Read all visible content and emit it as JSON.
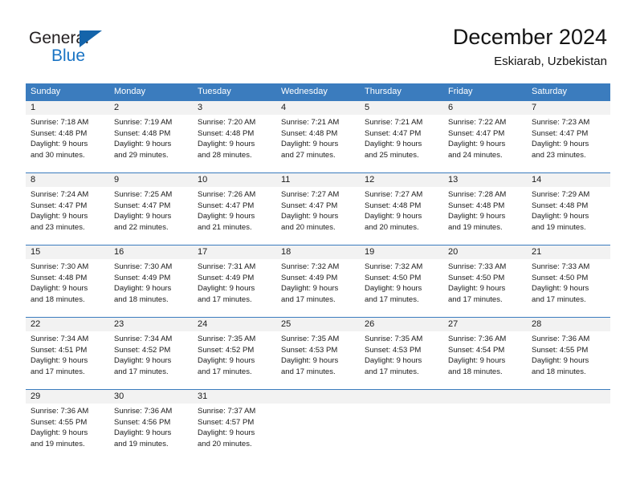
{
  "logo": {
    "word_top": "General",
    "word_bottom": "Blue",
    "triangle_color": "#1464aa",
    "blue_color": "#1a74c4"
  },
  "header": {
    "title": "December 2024",
    "subtitle": "Eskiarab, Uzbekistan"
  },
  "theme": {
    "header_blue": "#3b7cbe",
    "number_row_bg": "#f2f2f2",
    "text": "#1a1a1a"
  },
  "calendar": {
    "weekdays": [
      "Sunday",
      "Monday",
      "Tuesday",
      "Wednesday",
      "Thursday",
      "Friday",
      "Saturday"
    ],
    "weeks": [
      [
        {
          "day": "1",
          "sunrise": "Sunrise: 7:18 AM",
          "sunset": "Sunset: 4:48 PM",
          "daylight1": "Daylight: 9 hours",
          "daylight2": "and 30 minutes."
        },
        {
          "day": "2",
          "sunrise": "Sunrise: 7:19 AM",
          "sunset": "Sunset: 4:48 PM",
          "daylight1": "Daylight: 9 hours",
          "daylight2": "and 29 minutes."
        },
        {
          "day": "3",
          "sunrise": "Sunrise: 7:20 AM",
          "sunset": "Sunset: 4:48 PM",
          "daylight1": "Daylight: 9 hours",
          "daylight2": "and 28 minutes."
        },
        {
          "day": "4",
          "sunrise": "Sunrise: 7:21 AM",
          "sunset": "Sunset: 4:48 PM",
          "daylight1": "Daylight: 9 hours",
          "daylight2": "and 27 minutes."
        },
        {
          "day": "5",
          "sunrise": "Sunrise: 7:21 AM",
          "sunset": "Sunset: 4:47 PM",
          "daylight1": "Daylight: 9 hours",
          "daylight2": "and 25 minutes."
        },
        {
          "day": "6",
          "sunrise": "Sunrise: 7:22 AM",
          "sunset": "Sunset: 4:47 PM",
          "daylight1": "Daylight: 9 hours",
          "daylight2": "and 24 minutes."
        },
        {
          "day": "7",
          "sunrise": "Sunrise: 7:23 AM",
          "sunset": "Sunset: 4:47 PM",
          "daylight1": "Daylight: 9 hours",
          "daylight2": "and 23 minutes."
        }
      ],
      [
        {
          "day": "8",
          "sunrise": "Sunrise: 7:24 AM",
          "sunset": "Sunset: 4:47 PM",
          "daylight1": "Daylight: 9 hours",
          "daylight2": "and 23 minutes."
        },
        {
          "day": "9",
          "sunrise": "Sunrise: 7:25 AM",
          "sunset": "Sunset: 4:47 PM",
          "daylight1": "Daylight: 9 hours",
          "daylight2": "and 22 minutes."
        },
        {
          "day": "10",
          "sunrise": "Sunrise: 7:26 AM",
          "sunset": "Sunset: 4:47 PM",
          "daylight1": "Daylight: 9 hours",
          "daylight2": "and 21 minutes."
        },
        {
          "day": "11",
          "sunrise": "Sunrise: 7:27 AM",
          "sunset": "Sunset: 4:47 PM",
          "daylight1": "Daylight: 9 hours",
          "daylight2": "and 20 minutes."
        },
        {
          "day": "12",
          "sunrise": "Sunrise: 7:27 AM",
          "sunset": "Sunset: 4:48 PM",
          "daylight1": "Daylight: 9 hours",
          "daylight2": "and 20 minutes."
        },
        {
          "day": "13",
          "sunrise": "Sunrise: 7:28 AM",
          "sunset": "Sunset: 4:48 PM",
          "daylight1": "Daylight: 9 hours",
          "daylight2": "and 19 minutes."
        },
        {
          "day": "14",
          "sunrise": "Sunrise: 7:29 AM",
          "sunset": "Sunset: 4:48 PM",
          "daylight1": "Daylight: 9 hours",
          "daylight2": "and 19 minutes."
        }
      ],
      [
        {
          "day": "15",
          "sunrise": "Sunrise: 7:30 AM",
          "sunset": "Sunset: 4:48 PM",
          "daylight1": "Daylight: 9 hours",
          "daylight2": "and 18 minutes."
        },
        {
          "day": "16",
          "sunrise": "Sunrise: 7:30 AM",
          "sunset": "Sunset: 4:49 PM",
          "daylight1": "Daylight: 9 hours",
          "daylight2": "and 18 minutes."
        },
        {
          "day": "17",
          "sunrise": "Sunrise: 7:31 AM",
          "sunset": "Sunset: 4:49 PM",
          "daylight1": "Daylight: 9 hours",
          "daylight2": "and 17 minutes."
        },
        {
          "day": "18",
          "sunrise": "Sunrise: 7:32 AM",
          "sunset": "Sunset: 4:49 PM",
          "daylight1": "Daylight: 9 hours",
          "daylight2": "and 17 minutes."
        },
        {
          "day": "19",
          "sunrise": "Sunrise: 7:32 AM",
          "sunset": "Sunset: 4:50 PM",
          "daylight1": "Daylight: 9 hours",
          "daylight2": "and 17 minutes."
        },
        {
          "day": "20",
          "sunrise": "Sunrise: 7:33 AM",
          "sunset": "Sunset: 4:50 PM",
          "daylight1": "Daylight: 9 hours",
          "daylight2": "and 17 minutes."
        },
        {
          "day": "21",
          "sunrise": "Sunrise: 7:33 AM",
          "sunset": "Sunset: 4:50 PM",
          "daylight1": "Daylight: 9 hours",
          "daylight2": "and 17 minutes."
        }
      ],
      [
        {
          "day": "22",
          "sunrise": "Sunrise: 7:34 AM",
          "sunset": "Sunset: 4:51 PM",
          "daylight1": "Daylight: 9 hours",
          "daylight2": "and 17 minutes."
        },
        {
          "day": "23",
          "sunrise": "Sunrise: 7:34 AM",
          "sunset": "Sunset: 4:52 PM",
          "daylight1": "Daylight: 9 hours",
          "daylight2": "and 17 minutes."
        },
        {
          "day": "24",
          "sunrise": "Sunrise: 7:35 AM",
          "sunset": "Sunset: 4:52 PM",
          "daylight1": "Daylight: 9 hours",
          "daylight2": "and 17 minutes."
        },
        {
          "day": "25",
          "sunrise": "Sunrise: 7:35 AM",
          "sunset": "Sunset: 4:53 PM",
          "daylight1": "Daylight: 9 hours",
          "daylight2": "and 17 minutes."
        },
        {
          "day": "26",
          "sunrise": "Sunrise: 7:35 AM",
          "sunset": "Sunset: 4:53 PM",
          "daylight1": "Daylight: 9 hours",
          "daylight2": "and 17 minutes."
        },
        {
          "day": "27",
          "sunrise": "Sunrise: 7:36 AM",
          "sunset": "Sunset: 4:54 PM",
          "daylight1": "Daylight: 9 hours",
          "daylight2": "and 18 minutes."
        },
        {
          "day": "28",
          "sunrise": "Sunrise: 7:36 AM",
          "sunset": "Sunset: 4:55 PM",
          "daylight1": "Daylight: 9 hours",
          "daylight2": "and 18 minutes."
        }
      ],
      [
        {
          "day": "29",
          "sunrise": "Sunrise: 7:36 AM",
          "sunset": "Sunset: 4:55 PM",
          "daylight1": "Daylight: 9 hours",
          "daylight2": "and 19 minutes."
        },
        {
          "day": "30",
          "sunrise": "Sunrise: 7:36 AM",
          "sunset": "Sunset: 4:56 PM",
          "daylight1": "Daylight: 9 hours",
          "daylight2": "and 19 minutes."
        },
        {
          "day": "31",
          "sunrise": "Sunrise: 7:37 AM",
          "sunset": "Sunset: 4:57 PM",
          "daylight1": "Daylight: 9 hours",
          "daylight2": "and 20 minutes."
        },
        {
          "day": "",
          "sunrise": "",
          "sunset": "",
          "daylight1": "",
          "daylight2": ""
        },
        {
          "day": "",
          "sunrise": "",
          "sunset": "",
          "daylight1": "",
          "daylight2": ""
        },
        {
          "day": "",
          "sunrise": "",
          "sunset": "",
          "daylight1": "",
          "daylight2": ""
        },
        {
          "day": "",
          "sunrise": "",
          "sunset": "",
          "daylight1": "",
          "daylight2": ""
        }
      ]
    ]
  }
}
